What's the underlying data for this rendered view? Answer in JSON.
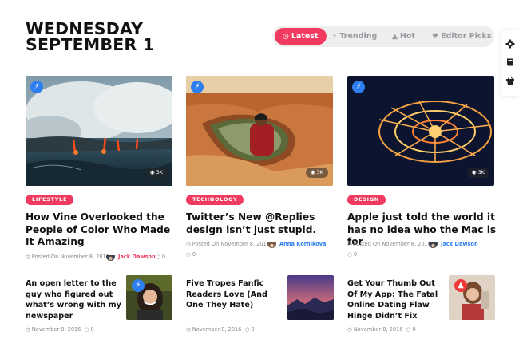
{
  "header": {
    "day": "WEDNESDAY",
    "date": "SEPTEMBER 1"
  },
  "tabs": [
    {
      "label": "Latest",
      "icon": "clock-icon",
      "active": true
    },
    {
      "label": "Trending",
      "icon": "bolt-icon",
      "active": false
    },
    {
      "label": "Hot",
      "icon": "flame-icon",
      "active": false
    },
    {
      "label": "Editor Picks",
      "icon": "heart-icon",
      "active": false
    }
  ],
  "sidebar": {
    "icons": [
      "gear-icon",
      "book-icon",
      "basket-icon"
    ]
  },
  "colors": {
    "accent": "#f03a5f",
    "badge_blue": "#2d7ef0",
    "author_pink": "#f03a5f",
    "author_blue": "#2d7ef0"
  },
  "posts": [
    {
      "category": "LIFESTYLE",
      "title": "How Vine Overlooked the People of Color Who Made It Amazing",
      "posted": "Posted On November 8, 2016",
      "author": "Jack Dawson",
      "comments": "0",
      "views": "3K"
    },
    {
      "category": "TECHNOLOGY",
      "title": "Twitter’s New @Replies design isn’t just stupid.",
      "posted": "Posted On November 8, 2016",
      "author": "Anna Kornikova",
      "comments": "0",
      "views": "3K"
    },
    {
      "category": "DESIGN",
      "title": "Apple just told the world it has no idea who the Mac is for",
      "posted": "Posted On November 8, 2016",
      "author": "Jack Dawson",
      "comments": "0",
      "views": "3K"
    }
  ],
  "mini_posts": [
    {
      "title": "An open letter to the guy who figured out what’s wrong with my newspaper",
      "date": "November 8, 2016",
      "comments": "0"
    },
    {
      "title": "Five Tropes Fanfic Readers Love (And One They Hate)",
      "date": "November 8, 2016",
      "comments": "0"
    },
    {
      "title": "Get Your Thumb Out Of My App: The Fatal Online Dating Flaw Hinge Didn’t Fix",
      "date": "November 8, 2016",
      "comments": "0"
    }
  ]
}
